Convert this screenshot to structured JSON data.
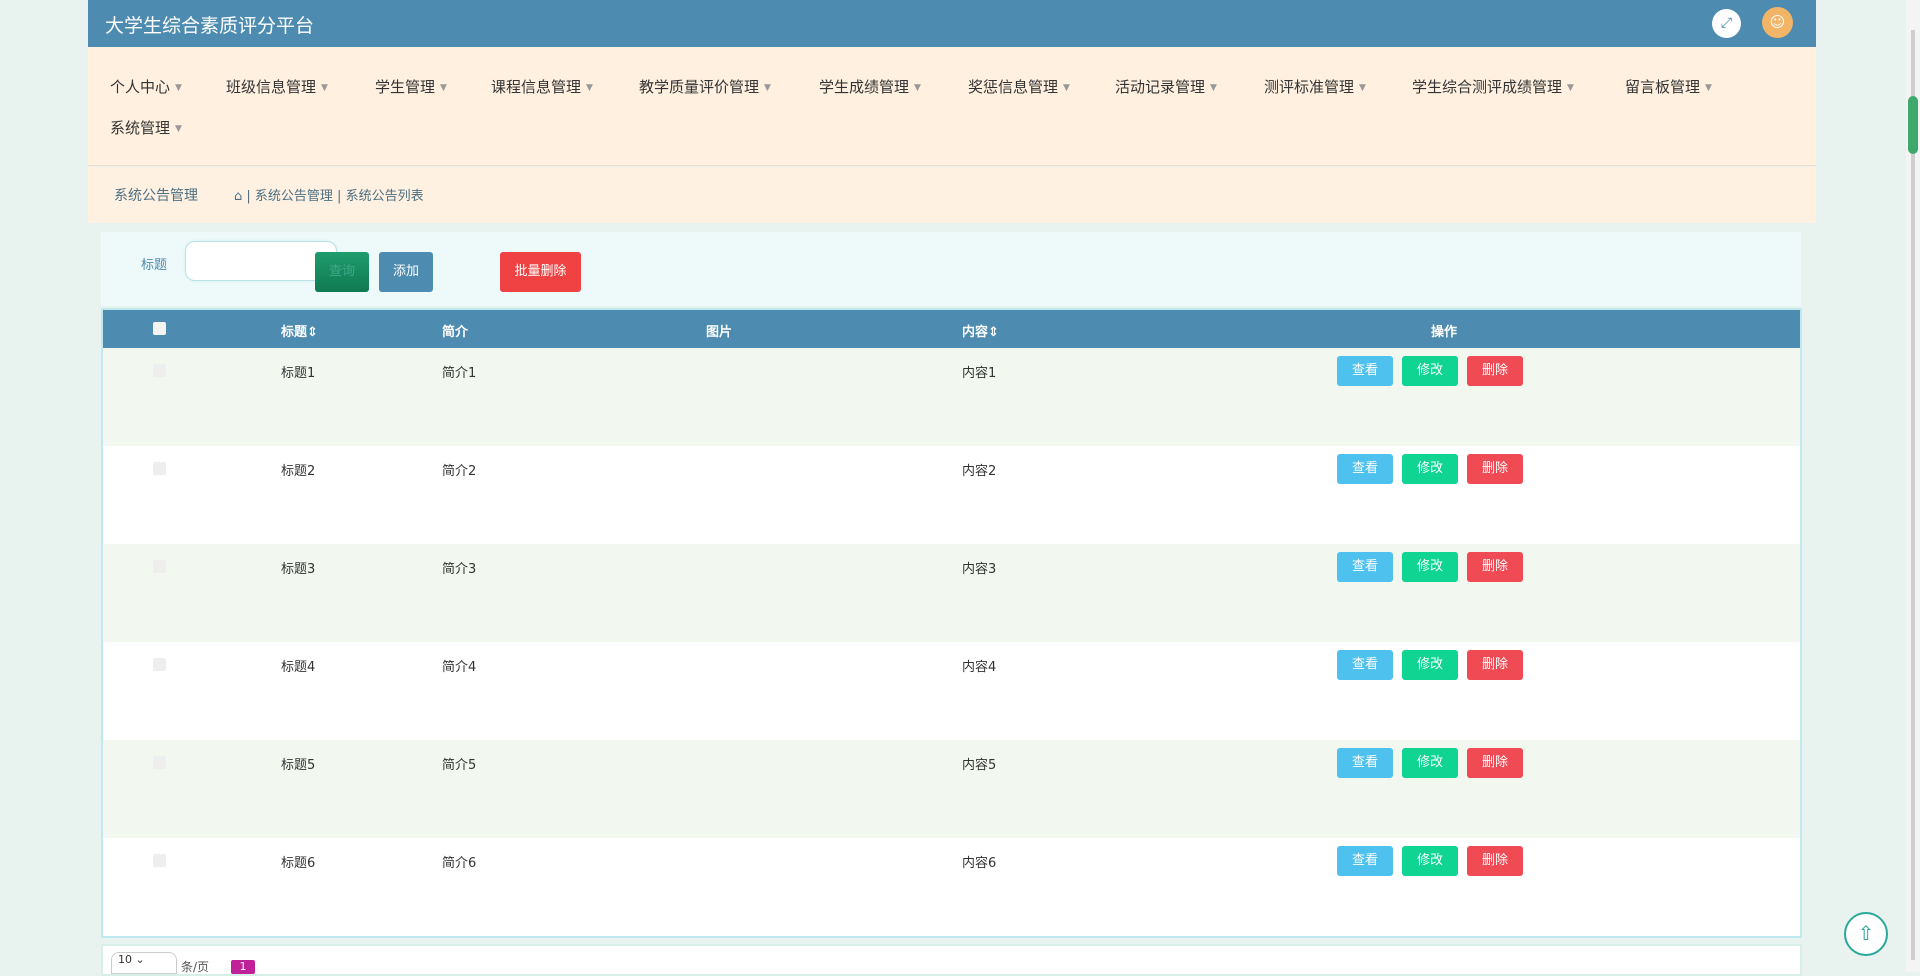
{
  "app": {
    "title": "大学生综合素质评分平台"
  },
  "nav": {
    "items": [
      {
        "label": "个人中心"
      },
      {
        "label": "班级信息管理"
      },
      {
        "label": "学生管理"
      },
      {
        "label": "课程信息管理"
      },
      {
        "label": "教学质量评价管理"
      },
      {
        "label": "学生成绩管理"
      },
      {
        "label": "奖惩信息管理"
      },
      {
        "label": "活动记录管理"
      },
      {
        "label": "测评标准管理"
      },
      {
        "label": "学生综合测评成绩管理"
      },
      {
        "label": "留言板管理"
      },
      {
        "label": "系统管理"
      }
    ]
  },
  "breadcrumb": {
    "section": "系统公告管理",
    "path": "| 系统公告管理 | 系统公告列表"
  },
  "search": {
    "label": "标题",
    "value": "",
    "search_label": "查询",
    "add_label": "添加",
    "batch_delete_label": "批量删除"
  },
  "table": {
    "headers": {
      "title": "标题",
      "intro": "简介",
      "image": "图片",
      "content": "内容",
      "actions": "操作"
    },
    "rows": [
      {
        "title": "标题1",
        "intro": "简介1",
        "content": "内容1"
      },
      {
        "title": "标题2",
        "intro": "简介2",
        "content": "内容2"
      },
      {
        "title": "标题3",
        "intro": "简介3",
        "content": "内容3"
      },
      {
        "title": "标题4",
        "intro": "简介4",
        "content": "内容4"
      },
      {
        "title": "标题5",
        "intro": "简介5",
        "content": "内容5"
      },
      {
        "title": "标题6",
        "intro": "简介6",
        "content": "内容6"
      }
    ],
    "row_actions": {
      "view": "查看",
      "edit": "修改",
      "delete": "删除"
    }
  },
  "pagination": {
    "page_size": "10",
    "per_page_text": "条/页",
    "current_page": "1"
  },
  "icons": {
    "expand": "fullscreen-icon",
    "avatar": "user-icon",
    "home": "home-icon",
    "scroll_top": "arrow-up-icon"
  },
  "colors": {
    "header": "#4d8bb0",
    "nav_bg": "#fff0e0",
    "view": "#4fc1ee",
    "edit": "#10d492",
    "delete": "#f04a55",
    "batch_delete": "#f04242"
  }
}
